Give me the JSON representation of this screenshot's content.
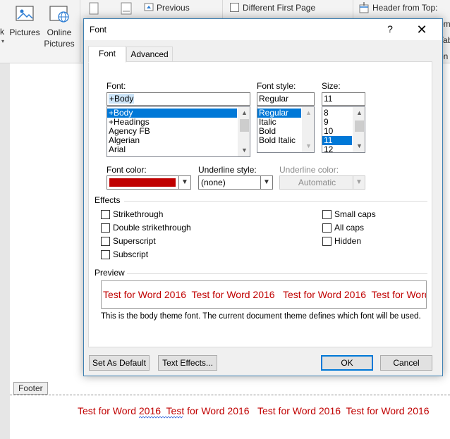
{
  "ribbon": {
    "partial_k_label": "k",
    "pictures_label": "Pictures",
    "online_pictures_label_line1": "Online",
    "online_pictures_label_line2": "Pictures",
    "previous_label": "Previous",
    "different_first_page_label": "Different First Page",
    "header_from_top_label": "Header from Top:",
    "partial_om_label": "om:",
    "partial_tab_label": "Tab",
    "partial_on_label": "on"
  },
  "document": {
    "footer_tab_label": "Footer",
    "footer_text": "Test for Word 2016  Test for Word 2016   Test for Word 2016  Test for Word 2016",
    "text_color": "#c00000"
  },
  "dialog": {
    "title": "Font",
    "help_symbol": "?",
    "close_symbol": "✕",
    "tabs": [
      {
        "label": "Font",
        "underline_char": "n",
        "active": true
      },
      {
        "label": "Advanced",
        "underline_char": "v",
        "active": false
      }
    ],
    "font": {
      "label": "Font:",
      "value": "+Body",
      "items": [
        "+Body",
        "+Headings",
        "Agency FB",
        "Algerian",
        "Arial"
      ],
      "selected_index": 0
    },
    "font_style": {
      "label": "Font style:",
      "value": "Regular",
      "items": [
        "Regular",
        "Italic",
        "Bold",
        "Bold Italic"
      ],
      "selected_index": 0
    },
    "size": {
      "label": "Size:",
      "value": "11",
      "items": [
        "8",
        "9",
        "10",
        "11",
        "12"
      ],
      "selected_index": 3
    },
    "font_color": {
      "label": "Font color:",
      "value_color": "#c00000"
    },
    "underline_style": {
      "label": "Underline style:",
      "value": "(none)"
    },
    "underline_color": {
      "label": "Underline color:",
      "value": "Automatic",
      "disabled": true
    },
    "effects": {
      "title": "Effects",
      "left": [
        {
          "label": "Strikethrough",
          "checked": false
        },
        {
          "label": "Double strikethrough",
          "checked": false
        },
        {
          "label": "Superscript",
          "checked": false
        },
        {
          "label": "Subscript",
          "checked": false
        }
      ],
      "right": [
        {
          "label": "Small caps",
          "checked": false
        },
        {
          "label": "All caps",
          "checked": false
        },
        {
          "label": "Hidden",
          "checked": false
        }
      ]
    },
    "preview": {
      "title": "Preview",
      "sample_text": "Test for Word 2016  Test for Word 2016   Test for Word 2016  Test for Word 2016",
      "note": "This is the body theme font. The current document theme defines which font will be used."
    },
    "buttons": {
      "set_default": "Set As Default",
      "text_effects": "Text Effects...",
      "ok": "OK",
      "cancel": "Cancel"
    },
    "colors": {
      "accent": "#0078d7",
      "selection": "#0078d7",
      "font_color_swatch": "#c00000",
      "border": "#3c7fb1"
    }
  }
}
